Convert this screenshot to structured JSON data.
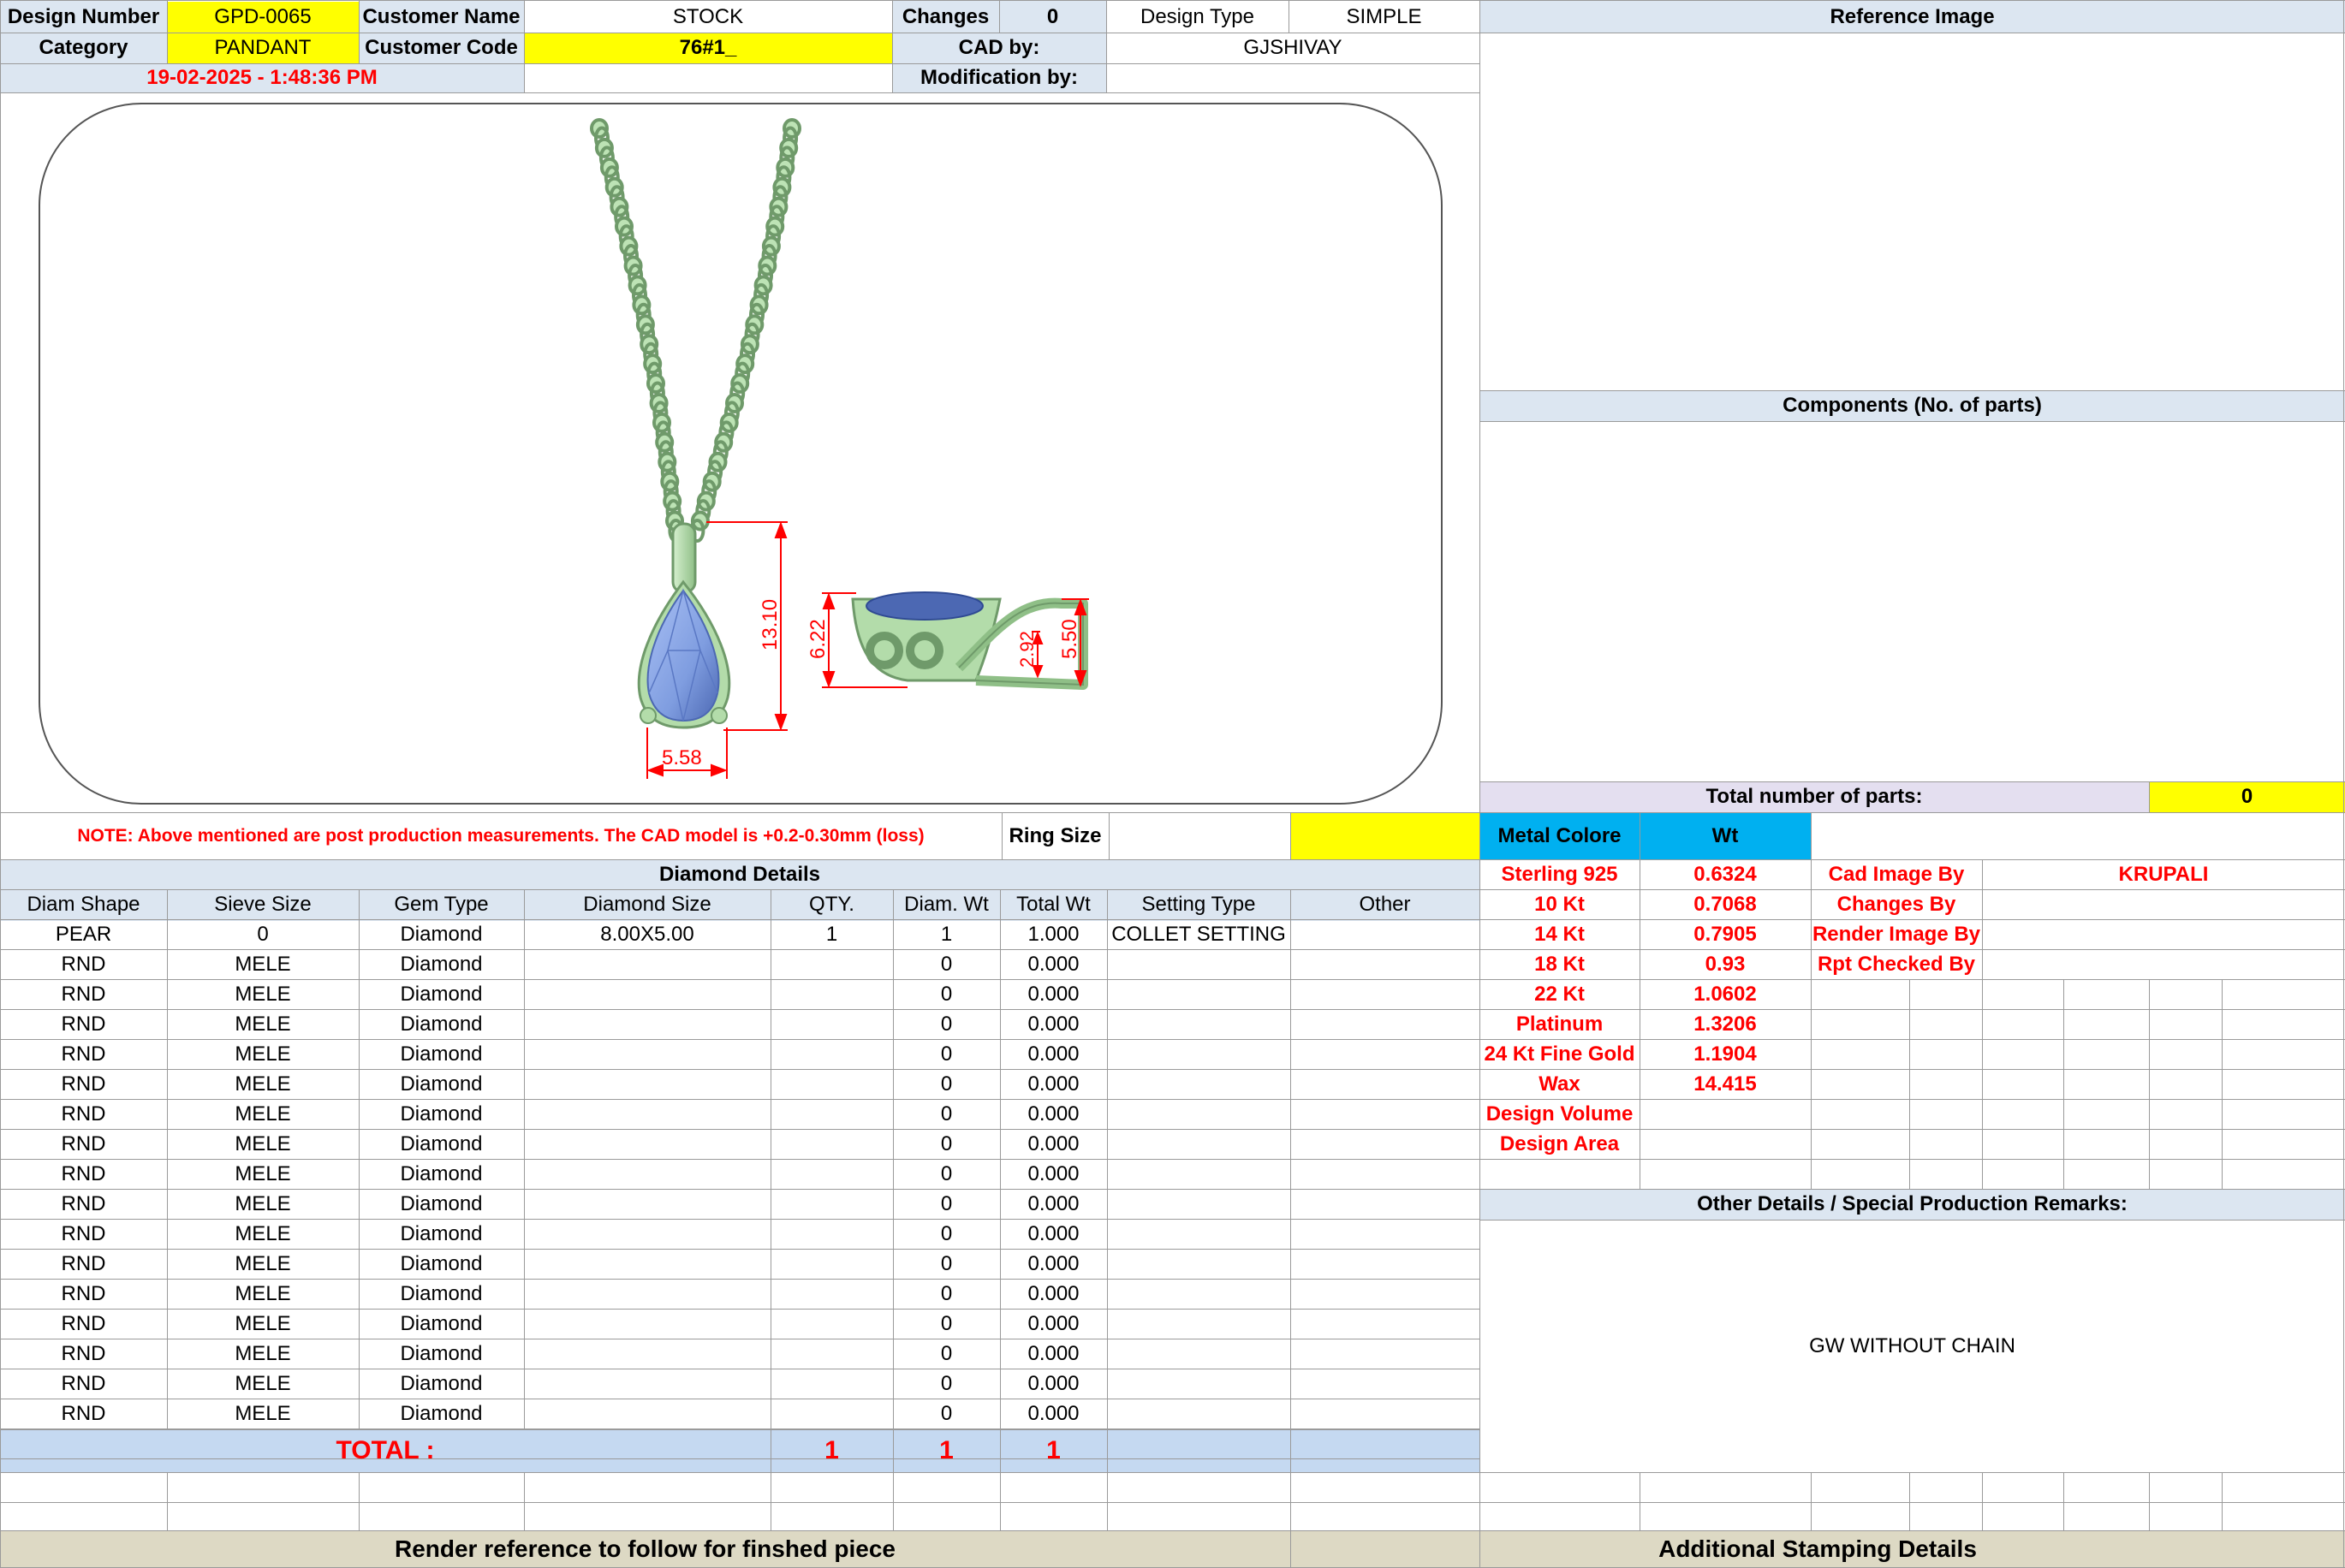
{
  "header": {
    "design_number_label": "Design Number",
    "design_number": "GPD-0065",
    "customer_name_label": "Customer Name",
    "customer_name": "STOCK",
    "changes_label": "Changes",
    "changes_value": "0",
    "design_type_label": "Design Type",
    "design_type": "SIMPLE",
    "category_label": "Category",
    "category": "PANDANT",
    "customer_code_label": "Customer Code",
    "customer_code": "76#1_",
    "cad_by_label": "CAD by:",
    "cad_by": "GJSHIVAY",
    "date": "19-02-2025 - 1:48:36 PM",
    "modification_by_label": "Modification by:"
  },
  "drawing": {
    "dim_height": "13.10",
    "dim_width": "5.58",
    "dim_side_height": "6.22",
    "dim_side_small": "2.92",
    "dim_side_right": "5.50"
  },
  "note": "NOTE: Above mentioned are post production measurements. The CAD model is +0.2-0.30mm (loss)",
  "ring_size_label": "Ring Size",
  "diamond_details": {
    "title": "Diamond Details",
    "headers": [
      "Diam Shape",
      "Sieve Size",
      "Gem Type",
      "Diamond Size",
      "QTY.",
      "Diam. Wt",
      "Total Wt",
      "Setting Type",
      "Other"
    ],
    "rows": [
      [
        "PEAR",
        "0",
        "Diamond",
        "8.00X5.00",
        "1",
        "1",
        "1.000",
        "COLLET SETTING",
        ""
      ],
      [
        "RND",
        "MELE",
        "Diamond",
        "",
        "",
        "0",
        "0.000",
        "",
        ""
      ],
      [
        "RND",
        "MELE",
        "Diamond",
        "",
        "",
        "0",
        "0.000",
        "",
        ""
      ],
      [
        "RND",
        "MELE",
        "Diamond",
        "",
        "",
        "0",
        "0.000",
        "",
        ""
      ],
      [
        "RND",
        "MELE",
        "Diamond",
        "",
        "",
        "0",
        "0.000",
        "",
        ""
      ],
      [
        "RND",
        "MELE",
        "Diamond",
        "",
        "",
        "0",
        "0.000",
        "",
        ""
      ],
      [
        "RND",
        "MELE",
        "Diamond",
        "",
        "",
        "0",
        "0.000",
        "",
        ""
      ],
      [
        "RND",
        "MELE",
        "Diamond",
        "",
        "",
        "0",
        "0.000",
        "",
        ""
      ],
      [
        "RND",
        "MELE",
        "Diamond",
        "",
        "",
        "0",
        "0.000",
        "",
        ""
      ],
      [
        "RND",
        "MELE",
        "Diamond",
        "",
        "",
        "0",
        "0.000",
        "",
        ""
      ],
      [
        "RND",
        "MELE",
        "Diamond",
        "",
        "",
        "0",
        "0.000",
        "",
        ""
      ],
      [
        "RND",
        "MELE",
        "Diamond",
        "",
        "",
        "0",
        "0.000",
        "",
        ""
      ],
      [
        "RND",
        "MELE",
        "Diamond",
        "",
        "",
        "0",
        "0.000",
        "",
        ""
      ],
      [
        "RND",
        "MELE",
        "Diamond",
        "",
        "",
        "0",
        "0.000",
        "",
        ""
      ],
      [
        "RND",
        "MELE",
        "Diamond",
        "",
        "",
        "0",
        "0.000",
        "",
        ""
      ],
      [
        "RND",
        "MELE",
        "Diamond",
        "",
        "",
        "0",
        "0.000",
        "",
        ""
      ],
      [
        "RND",
        "MELE",
        "Diamond",
        "",
        "",
        "0",
        "0.000",
        "",
        ""
      ]
    ],
    "total_label": "TOTAL :",
    "total_qty": "1",
    "total_diam_wt": "1",
    "total_wt": "1"
  },
  "right_panel": {
    "reference_image_title": "Reference Image",
    "components_title": "Components (No. of parts)",
    "total_parts_label": "Total number of parts:",
    "total_parts_value": "0",
    "metal_colore_label": "Metal Colore",
    "wt_label": "Wt",
    "metals": [
      {
        "name": "Sterling 925",
        "wt": "0.6324"
      },
      {
        "name": "10 Kt",
        "wt": "0.7068"
      },
      {
        "name": "14 Kt",
        "wt": "0.7905"
      },
      {
        "name": "18 Kt",
        "wt": "0.93"
      },
      {
        "name": "22 Kt",
        "wt": "1.0602"
      },
      {
        "name": "Platinum",
        "wt": "1.3206"
      },
      {
        "name": "24 Kt Fine Gold",
        "wt": "1.1904"
      },
      {
        "name": "Wax",
        "wt": "14.415"
      },
      {
        "name": "Design Volume",
        "wt": ""
      },
      {
        "name": "Design Area",
        "wt": ""
      }
    ],
    "people": [
      {
        "label": "Cad Image By",
        "value": "KRUPALI"
      },
      {
        "label": "Changes By",
        "value": ""
      },
      {
        "label": "Render Image By",
        "value": ""
      },
      {
        "label": "Rpt Checked By",
        "value": ""
      }
    ],
    "other_details_title": "Other Details / Special Production Remarks:",
    "remarks": "GW WITHOUT CHAIN"
  },
  "footer": {
    "render_reference": "Render reference to follow for finshed piece",
    "additional_stamping": "Additional Stamping Details"
  },
  "colors": {
    "metal": "#bde3b5",
    "metal_dark": "#6f9a6a",
    "gem": "#7f9de0",
    "gem_dark": "#4c68b3",
    "dimension": "#ff0000"
  }
}
